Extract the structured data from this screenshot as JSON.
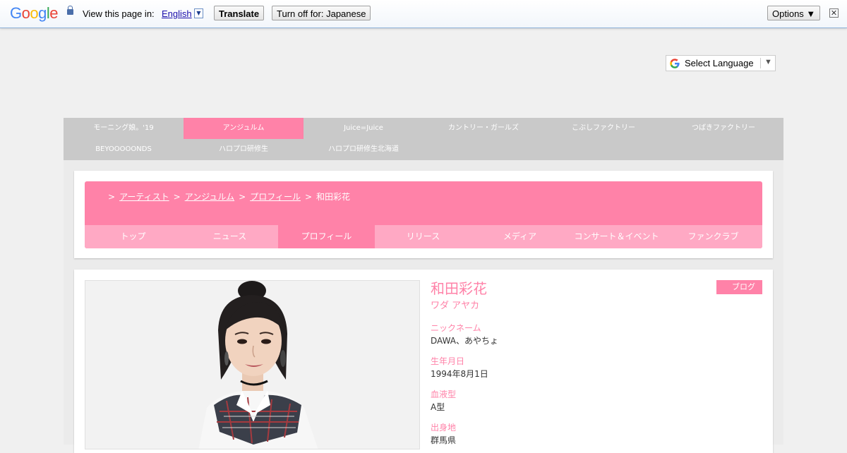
{
  "translate_bar": {
    "logo_letters": [
      {
        "ch": "G",
        "color": "#4285f4"
      },
      {
        "ch": "o",
        "color": "#ea4335"
      },
      {
        "ch": "o",
        "color": "#fbbc05"
      },
      {
        "ch": "g",
        "color": "#4285f4"
      },
      {
        "ch": "l",
        "color": "#34a853"
      },
      {
        "ch": "e",
        "color": "#ea4335"
      }
    ],
    "view_label": "View this page in:",
    "language": "English",
    "language_arrow": "▼",
    "translate_button": "Translate",
    "turn_off_button": "Turn off for: Japanese",
    "options_button": "Options ▼",
    "close": "✕"
  },
  "select_language": {
    "label": "Select Language",
    "arrow": "▼"
  },
  "group_nav": {
    "items": [
      {
        "label": "モーニング娘。'19",
        "active": false
      },
      {
        "label": "アンジュルム",
        "active": true
      },
      {
        "label": "Juice=Juice",
        "active": false
      },
      {
        "label": "カントリー・ガールズ",
        "active": false
      },
      {
        "label": "こぶしファクトリー",
        "active": false
      },
      {
        "label": "つばきファクトリー",
        "active": false
      },
      {
        "label": "BEYOOOOONDS",
        "active": false
      },
      {
        "label": "ハロプロ研修生",
        "active": false
      },
      {
        "label": "ハロプロ研修生北海道",
        "active": false
      }
    ]
  },
  "breadcrumb": {
    "separator": ">",
    "links": [
      "アーティスト",
      "アンジュルム",
      "プロフィール"
    ],
    "current": "和田彩花"
  },
  "sub_nav": {
    "items": [
      {
        "label": "トップ",
        "active": false
      },
      {
        "label": "ニュース",
        "active": false
      },
      {
        "label": "プロフィール",
        "active": true
      },
      {
        "label": "リリース",
        "active": false
      },
      {
        "label": "メディア",
        "active": false
      },
      {
        "label": "コンサート＆イベント",
        "active": false
      },
      {
        "label": "ファンクラブ",
        "active": false
      }
    ]
  },
  "profile": {
    "name": "和田彩花",
    "kana": "ワダ アヤカ",
    "blog_button": "ブログ",
    "fields": [
      {
        "label": "ニックネーム",
        "value": "DAWA、あやちょ"
      },
      {
        "label": "生年月日",
        "value": "1994年8月1日"
      },
      {
        "label": "血液型",
        "value": "A型"
      },
      {
        "label": "出身地",
        "value": "群馬県"
      }
    ]
  },
  "colors": {
    "accent_pink": "#ff82a8",
    "light_pink": "#ffa9c4",
    "nav_gray": "#c9c9c9"
  }
}
